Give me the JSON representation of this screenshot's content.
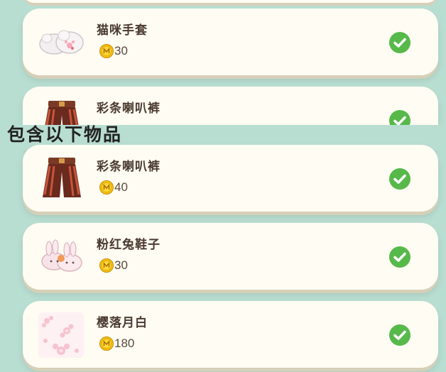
{
  "section_title": "包含以下物品",
  "colors": {
    "background": "#b8ddd1",
    "card": "#fffcf3",
    "check": "#56b94a",
    "coin": "#f3c012"
  },
  "items": [
    {
      "name": "猫咪手套",
      "price": "30",
      "icon": "cat-gloves-icon",
      "owned": true
    },
    {
      "name": "彩条喇叭裤",
      "price": "",
      "icon": "striped-bell-bottoms-icon",
      "owned": true
    },
    {
      "name": "彩条喇叭裤",
      "price": "40",
      "icon": "striped-bell-bottoms-icon",
      "owned": true
    },
    {
      "name": "粉红兔鞋子",
      "price": "30",
      "icon": "pink-bunny-shoes-icon",
      "owned": true
    },
    {
      "name": "樱落月白",
      "price": "180",
      "icon": "sakura-pattern-icon",
      "owned": true
    }
  ]
}
